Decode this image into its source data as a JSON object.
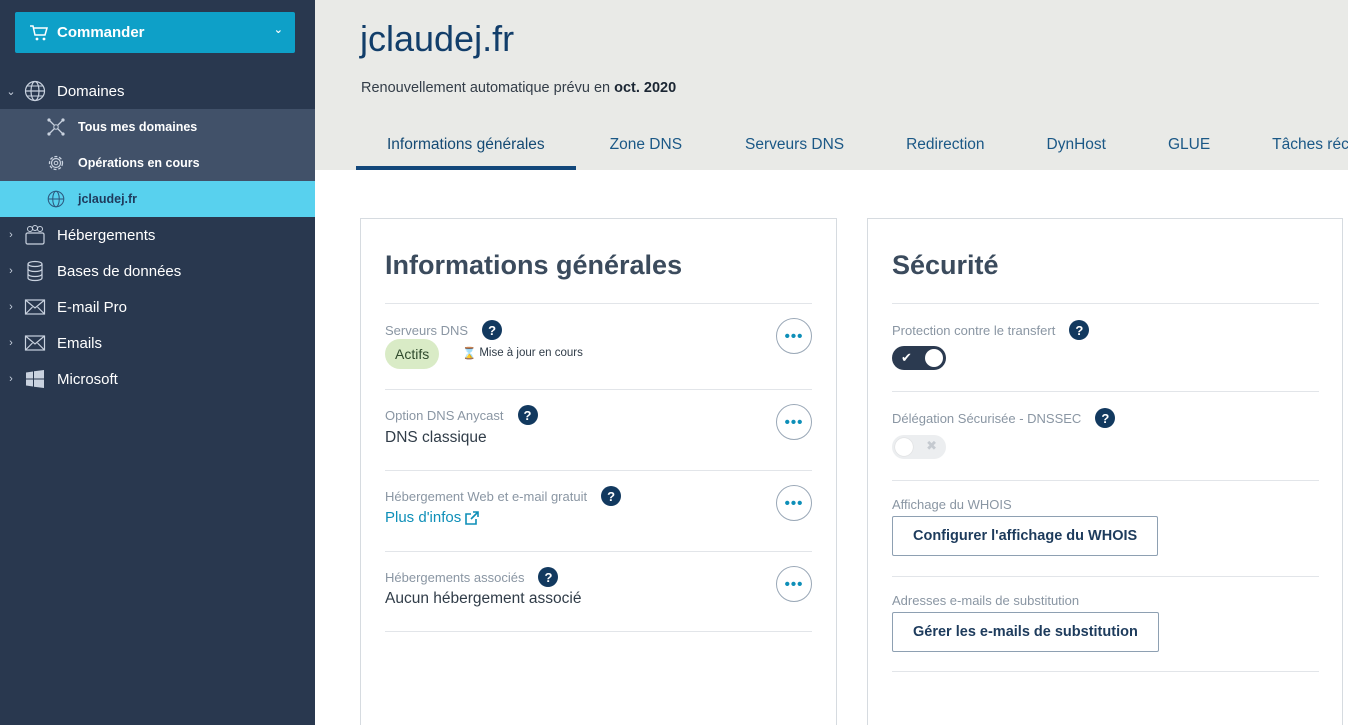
{
  "sidebar": {
    "order_label": "Commander",
    "items": [
      {
        "label": "Domaines",
        "icon": "globe-icon"
      },
      {
        "label": "Hébergements",
        "icon": "hosting-icon"
      },
      {
        "label": "Bases de données",
        "icon": "database-icon"
      },
      {
        "label": "E-mail Pro",
        "icon": "mail-icon"
      },
      {
        "label": "Emails",
        "icon": "mail-icon"
      },
      {
        "label": "Microsoft",
        "icon": "windows-icon"
      }
    ],
    "sub_items": [
      {
        "label": "Tous mes domaines",
        "icon": "network-icon"
      },
      {
        "label": "Opérations en cours",
        "icon": "gear-icon"
      },
      {
        "label": "jclaudej.fr",
        "icon": "globe-icon"
      }
    ]
  },
  "header": {
    "title": "jclaudej.fr",
    "renew_prefix": "Renouvellement automatique prévu en",
    "renew_date": "oct. 2020"
  },
  "tabs": [
    "Informations générales",
    "Zone DNS",
    "Serveurs DNS",
    "Redirection",
    "DynHost",
    "GLUE",
    "Tâches récentes"
  ],
  "general": {
    "title": "Informations générales",
    "dns_servers": {
      "label": "Serveurs DNS",
      "status": "Actifs",
      "updating": "Mise à jour en cours"
    },
    "anycast": {
      "label": "Option DNS Anycast",
      "value": "DNS classique"
    },
    "web_hosting": {
      "label": "Hébergement Web et e-mail gratuit",
      "link": "Plus d'infos"
    },
    "associated": {
      "label": "Hébergements associés",
      "value": "Aucun hébergement associé"
    }
  },
  "security": {
    "title": "Sécurité",
    "transfer": {
      "label": "Protection contre le transfert",
      "enabled": true
    },
    "dnssec": {
      "label": "Délégation Sécurisée - DNSSEC",
      "enabled": false
    },
    "whois": {
      "label": "Affichage du WHOIS",
      "button": "Configurer l'affichage du WHOIS"
    },
    "emails": {
      "label": "Adresses e-mails de substitution",
      "button": "Gérer les e-mails de substitution"
    }
  },
  "colors": {
    "sidebar": "#29384f",
    "accent": "#0ea0c8",
    "active_item": "#58d1ee",
    "badge": "#d9ebc6"
  }
}
